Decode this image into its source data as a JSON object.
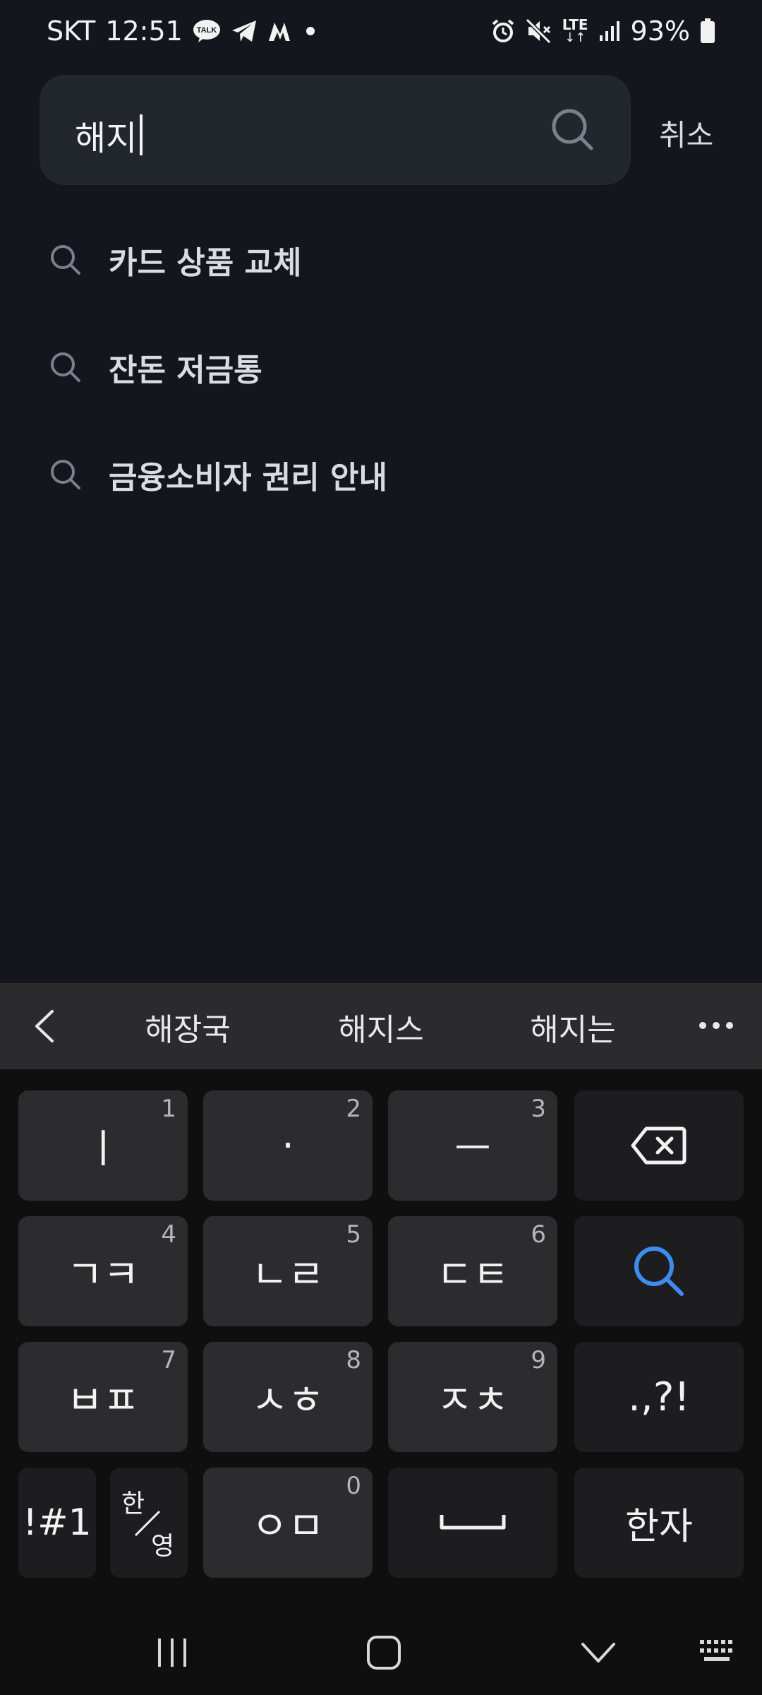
{
  "status_bar": {
    "carrier": "SKT",
    "time": "12:51",
    "talk_badge": "TALK",
    "network": "LTE",
    "battery": "93%",
    "notification_icons": [
      "kakaotalk-icon",
      "telegram-icon",
      "m-app-icon",
      "dot-icon"
    ],
    "system_icons": [
      "alarm-icon",
      "mute-icon",
      "lte-icon",
      "signal-icon",
      "battery-icon"
    ]
  },
  "search": {
    "query": "해지",
    "cancel_label": "취소"
  },
  "suggestions": [
    {
      "label": "카드 상품 교체"
    },
    {
      "label": "잔돈 저금통"
    },
    {
      "label": "금융소비자 권리 안내"
    }
  ],
  "keyboard": {
    "predictions": [
      "해장국",
      "해지스",
      "해지는"
    ],
    "keys": {
      "k1": {
        "label": "ㅣ",
        "hint": "1"
      },
      "k2": {
        "label": "·",
        "hint": "2"
      },
      "k3": {
        "label": "ㅡ",
        "hint": "3"
      },
      "k4": {
        "label": "ㄱㅋ",
        "hint": "4"
      },
      "k5": {
        "label": "ㄴㄹ",
        "hint": "5"
      },
      "k6": {
        "label": "ㄷㅌ",
        "hint": "6"
      },
      "k7": {
        "label": "ㅂㅍ",
        "hint": "7"
      },
      "k8": {
        "label": "ㅅㅎ",
        "hint": "8"
      },
      "k9": {
        "label": "ㅈㅊ",
        "hint": "9"
      },
      "k0": {
        "label": "ㅇㅁ",
        "hint": "0"
      },
      "punct": {
        "label": ".,?!"
      },
      "symbols": {
        "label": "!#1"
      },
      "lang_top": "한",
      "lang_bottom": "영",
      "hanja": {
        "label": "한자"
      }
    }
  },
  "colors": {
    "background": "#13161c",
    "search_field": "#22262d",
    "accent_search_key": "#3d8cf0"
  }
}
